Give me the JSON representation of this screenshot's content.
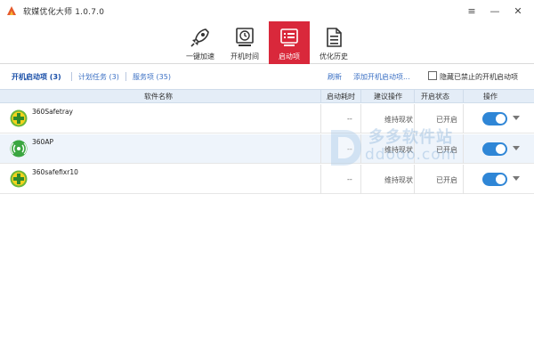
{
  "window": {
    "title": "软媒优化大师 1.0.7.0",
    "menu_glyph": "≡",
    "min_glyph": "—",
    "close_glyph": "✕"
  },
  "toolbar": [
    {
      "label": "一键加速",
      "icon": "rocket-icon"
    },
    {
      "label": "开机时间",
      "icon": "clock-icon"
    },
    {
      "label": "启动项",
      "icon": "startup-list-icon",
      "active": true
    },
    {
      "label": "优化历史",
      "icon": "document-icon"
    }
  ],
  "tabs": [
    {
      "label": "开机启动项 (3)",
      "current": true
    },
    {
      "label": "计划任务 (3)"
    },
    {
      "label": "服务项 (35)"
    }
  ],
  "actions": {
    "refresh": "刷新",
    "add_startup": "添加开机启动项..."
  },
  "filter": {
    "hide_disabled_label": "隐藏已禁止的开机启动项",
    "hide_disabled_checked": false
  },
  "columns": {
    "name": "软件名称",
    "time": "启动耗时",
    "suggest": "建议操作",
    "status": "开启状态",
    "operate": "操作"
  },
  "rows": [
    {
      "name": "360Safetray",
      "time": "--",
      "suggest": "维持现状",
      "status": "已开启",
      "enabled": true,
      "icon": "360-safe-icon"
    },
    {
      "name": "360AP",
      "time": "--",
      "suggest": "维持现状",
      "status": "已开启",
      "enabled": true,
      "icon": "wifi-ap-icon"
    },
    {
      "name": "360safefixr10",
      "time": "--",
      "suggest": "维持现状",
      "status": "已开启",
      "enabled": true,
      "icon": "360-safe-icon"
    }
  ],
  "watermark": {
    "cn": "多多软件站",
    "en": "ddooo.com"
  },
  "colors": {
    "accent_red": "#d9283b",
    "link_blue": "#3b70c4",
    "toggle_blue": "#2f86d6",
    "header_bg": "#e4edf7",
    "alt_row_bg": "#eef4fb"
  }
}
